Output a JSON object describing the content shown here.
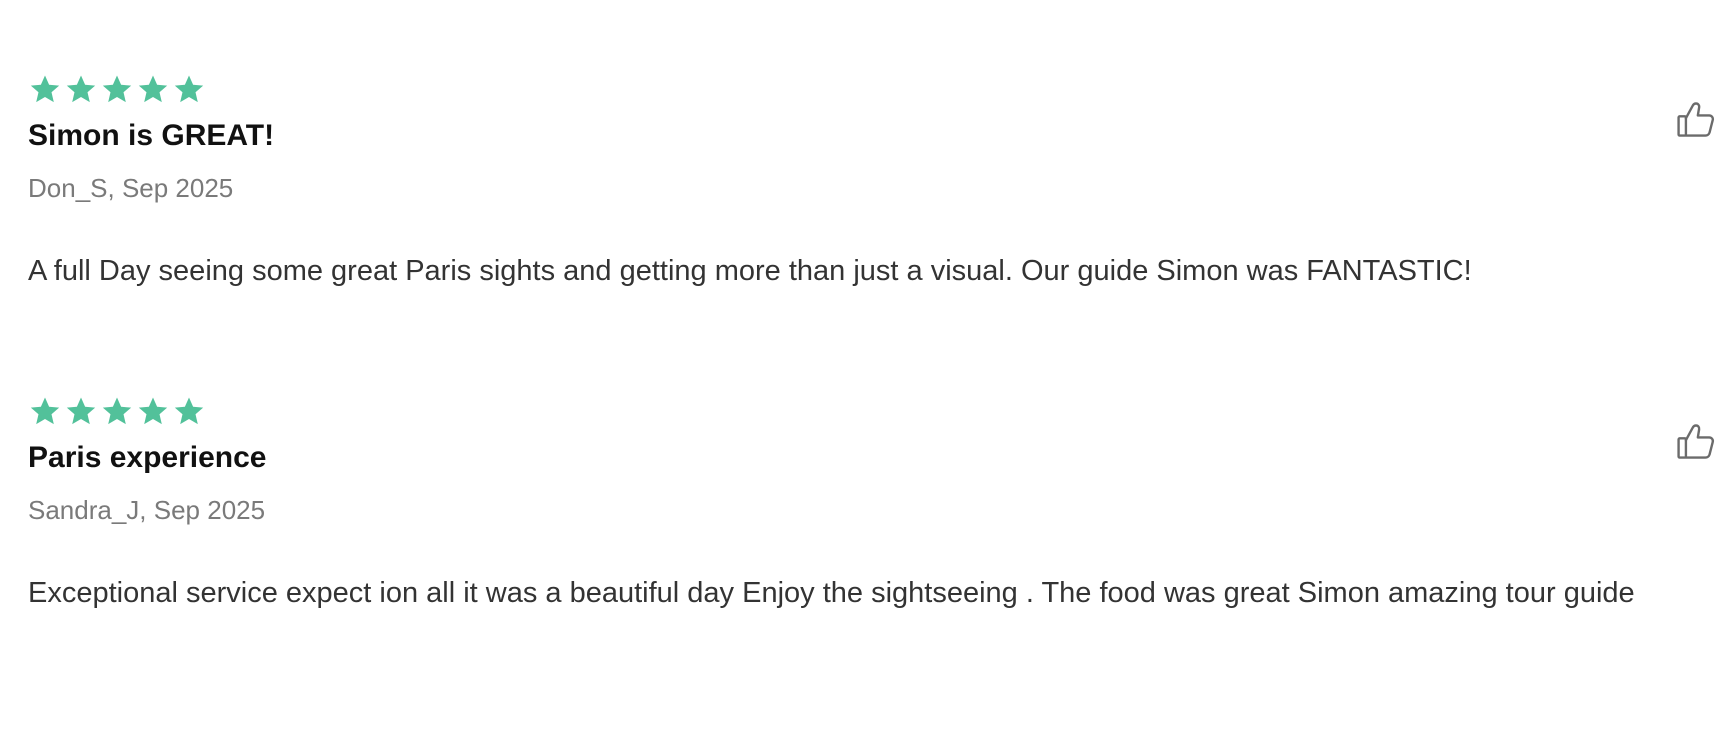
{
  "colors": {
    "star": "#52c19a",
    "title": "#111111",
    "meta": "#7a7a7a",
    "body": "#333333",
    "icon": "#6b6b6b"
  },
  "reviews": [
    {
      "rating": 5,
      "title": "Simon is GREAT!",
      "meta": "Don_S, Sep 2025",
      "body": "A full Day seeing some great Paris sights and getting more than just a visual. Our guide Simon was FANTASTIC!",
      "like_icon": "thumbs-up-icon"
    },
    {
      "rating": 5,
      "title": "Paris experience",
      "meta": "Sandra_J, Sep 2025",
      "body": "Exceptional service expect ion all it was a beautiful day Enjoy the sightseeing . The food was great Simon amazing tour guide",
      "like_icon": "thumbs-up-icon"
    }
  ]
}
